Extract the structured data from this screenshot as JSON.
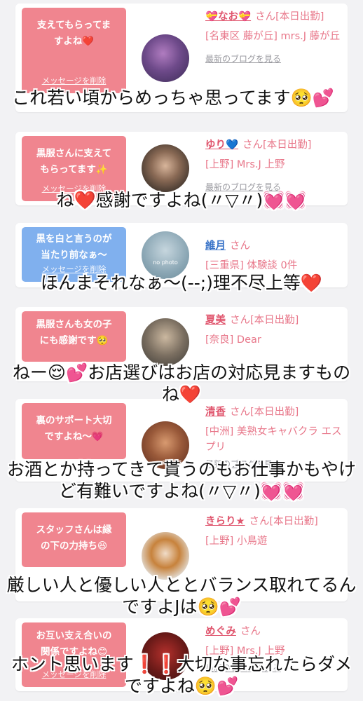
{
  "cards": [
    {
      "bubble_text": "支えてもらってま すよね❤️",
      "bubble_color": "pink",
      "delete_label": "メッセージを削除",
      "name": "💝なお💝",
      "suffix": "さん[本日出勤]",
      "shop": "[名東区 藤が丘] mrs.J 藤が丘",
      "blog": "最新のブログを見る",
      "avatar_colors": [
        "#3a2a55",
        "#b07cc0"
      ]
    },
    {
      "bubble_text": "黒服さんに支えて もらってます✨",
      "bubble_color": "pink",
      "delete_label": "メッセージを削除",
      "name": "ゆり💙",
      "suffix": "さん[本日出勤]",
      "shop": "[上野] Mrs.J 上野",
      "blog": "最新のブログを見る",
      "avatar_colors": [
        "#2b2622",
        "#d8b59b"
      ]
    },
    {
      "bubble_text": "黒を白と言うのが 当たり前なぁ〜",
      "bubble_color": "blue",
      "delete_label": "メッセージを削除",
      "name": "維月",
      "suffix": "さん",
      "shop": "[三重県] 体験談 0件",
      "blog": "",
      "avatar_label": "no photo",
      "avatar_colors": [
        "#8aa6b4",
        "#c6d6de"
      ]
    },
    {
      "bubble_text": "黒服さんも女の子 にも感謝です🥺",
      "bubble_color": "pink",
      "delete_label": "メッセージを削除",
      "name": "夏美",
      "suffix": "さん[本日出勤]",
      "shop": "[奈良] Dear",
      "blog": "最新のブログを見る",
      "avatar_colors": [
        "#3c3a36",
        "#cbb8a0"
      ]
    },
    {
      "bubble_text": "裏のサポート大切 ですよね〜💗",
      "bubble_color": "pink",
      "delete_label": "メッセージを削除",
      "name": "清香",
      "suffix": "さん[本日出勤]",
      "shop": "[中洲] 美熟女キャバクラ エスプリ",
      "blog": "最新のブログを見る",
      "avatar_colors": [
        "#5a2a1c",
        "#d89a70"
      ]
    },
    {
      "bubble_text": "スタッフさんは縁 の下の力持ち😆",
      "bubble_color": "pink",
      "delete_label": "メッセージを削除",
      "name": "きらり★",
      "suffix": "さん[本日出勤]",
      "shop": "[上野] 小鳥遊",
      "blog": "最新のブログを見る",
      "avatar_colors": [
        "#e2ddd6",
        "#c7823c"
      ]
    },
    {
      "bubble_text": "お互い支え合いの 関係ですよね😊",
      "bubble_color": "pink",
      "delete_label": "メッセージを削除",
      "name": "めぐみ",
      "suffix": "さん",
      "shop": "[上野] Mrs.J 上野",
      "blog": "最新のブログを見る",
      "avatar_colors": [
        "#3a1010",
        "#b3302c"
      ]
    }
  ],
  "captions": [
    "これ若い頃からめっちゃ思ってます🥺💕",
    "ね❤️感謝ですよね(〃▽〃)💓💓",
    "ほんまそれなぁ〜(--;)理不尽上等❤️",
    "ねー😌💕お店選びはお店の対応見ますものね❤️",
    "お酒とか持ってきて貰うのもお仕事かもやけど有難いですよね(〃▽〃)💓💓",
    "厳しい人と優しい人ととバランス取れてるんですよJは🥺💕",
    "ホント思います❗️❗️大切な事忘れたらダメですよね🥺💕"
  ]
}
